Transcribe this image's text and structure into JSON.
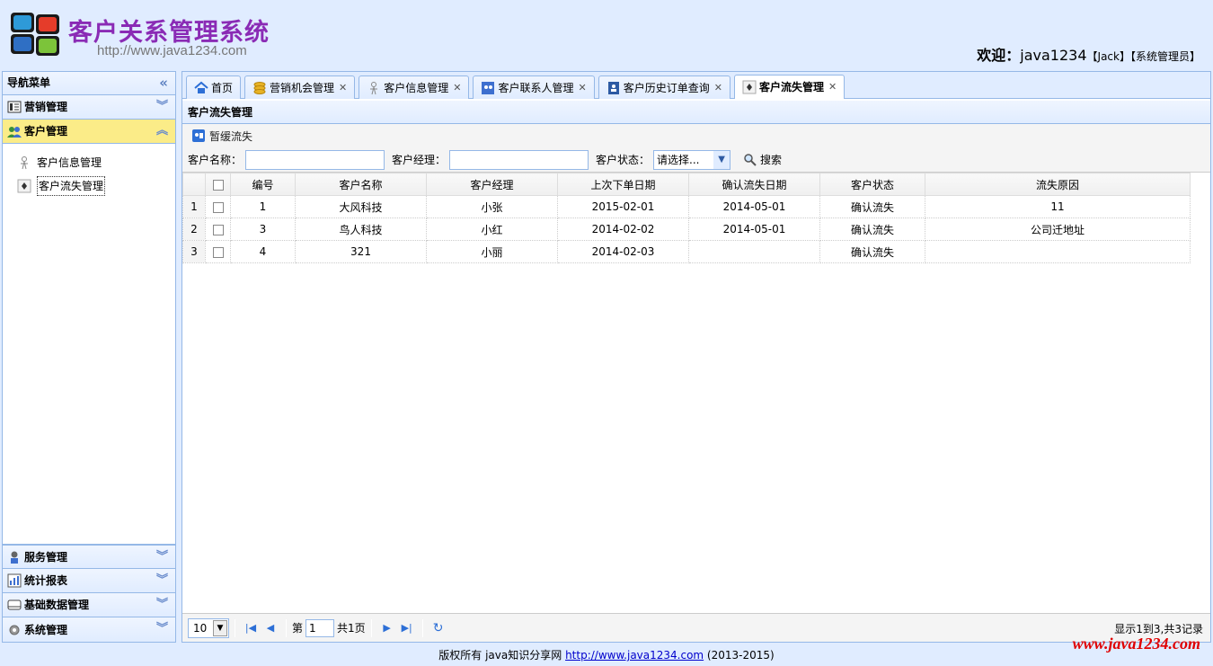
{
  "header": {
    "title": "客户关系管理系统",
    "url": "http://www.java1234.com",
    "welcome_label": "欢迎：",
    "username": "java1234",
    "user_alias": "【Jack】",
    "user_role": "【系统管理员】"
  },
  "nav": {
    "title": "导航菜单",
    "collapse_glyph": "«",
    "sections": [
      {
        "label": "营销管理",
        "icon": "sales-icon"
      },
      {
        "label": "客户管理",
        "icon": "customer-icon"
      },
      {
        "label": "服务管理",
        "icon": "service-icon"
      },
      {
        "label": "统计报表",
        "icon": "report-icon"
      },
      {
        "label": "基础数据管理",
        "icon": "database-icon"
      },
      {
        "label": "系统管理",
        "icon": "gear-icon"
      }
    ],
    "customer_items": [
      {
        "label": "客户信息管理"
      },
      {
        "label": "客户流失管理"
      }
    ]
  },
  "tabs": [
    {
      "label": "首页",
      "icon": "home-icon"
    },
    {
      "label": "营销机会管理",
      "icon": "coins-icon"
    },
    {
      "label": "客户信息管理",
      "icon": "person-icon"
    },
    {
      "label": "客户联系人管理",
      "icon": "contacts-icon"
    },
    {
      "label": "客户历史订单查询",
      "icon": "order-icon"
    },
    {
      "label": "客户流失管理",
      "icon": "loss-icon"
    }
  ],
  "panel": {
    "title": "客户流失管理",
    "toolbar_button": "暂缓流失",
    "search": {
      "customer_name_label": "客户名称：",
      "customer_name_value": "",
      "manager_label": "客户经理：",
      "manager_value": "",
      "status_label": "客户状态：",
      "status_selected": "请选择...",
      "search_button": "搜索"
    }
  },
  "grid": {
    "columns": [
      "编号",
      "客户名称",
      "客户经理",
      "上次下单日期",
      "确认流失日期",
      "客户状态",
      "流失原因"
    ],
    "rows": [
      {
        "rn": "1",
        "id": "1",
        "name": "大风科技",
        "manager": "小张",
        "last_order": "2015-02-01",
        "loss_date": "2014-05-01",
        "status": "确认流失",
        "reason": "11"
      },
      {
        "rn": "2",
        "id": "3",
        "name": "鸟人科技",
        "manager": "小红",
        "last_order": "2014-02-02",
        "loss_date": "2014-05-01",
        "status": "确认流失",
        "reason": "公司迁地址"
      },
      {
        "rn": "3",
        "id": "4",
        "name": "321",
        "manager": "小丽",
        "last_order": "2014-02-03",
        "loss_date": "",
        "status": "确认流失",
        "reason": ""
      }
    ]
  },
  "pager": {
    "page_size": "10",
    "page_prefix": "第",
    "page_number": "1",
    "page_total": "共1页",
    "info": "显示1到3,共3记录"
  },
  "footer": {
    "text_prefix": "版权所有 java知识分享网 ",
    "link": "http://www.java1234.com",
    "text_suffix": " (2013-2015)"
  },
  "watermark": "www.java1234.com",
  "colors": {
    "title_purple": "#8a2bb5",
    "border_blue": "#95B8E7",
    "bg_blue": "#E0ECFF",
    "selected_yellow": "#FBEC88",
    "watermark_red": "#e00000"
  }
}
